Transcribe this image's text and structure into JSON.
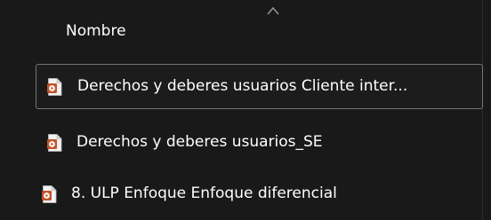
{
  "header": {
    "column_name": "Nombre",
    "sort_icon": "chevron-up-icon"
  },
  "files": [
    {
      "name": "Derechos y deberes usuarios Cliente inter...",
      "icon": "video-file-icon",
      "selected": true
    },
    {
      "name": "Derechos y deberes usuarios_SE",
      "icon": "video-file-icon",
      "selected": false
    },
    {
      "name": "8. ULP Enfoque Enfoque diferencial",
      "icon": "video-file-icon",
      "selected": false
    }
  ],
  "colors": {
    "background": "#191919",
    "selection_border": "#757575",
    "icon_accent": "#c4522a",
    "text": "#ffffff"
  }
}
